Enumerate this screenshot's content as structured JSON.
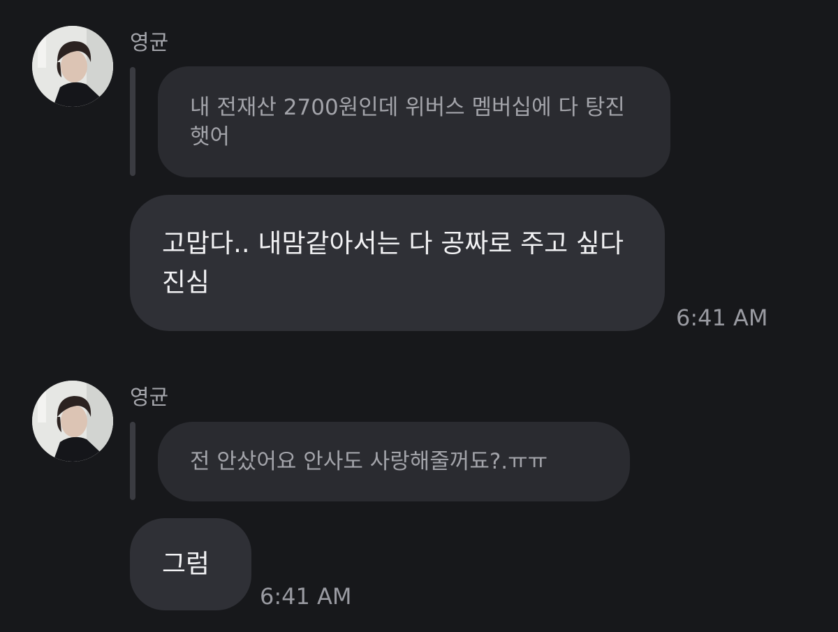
{
  "conversation": {
    "messages": [
      {
        "sender": "영균",
        "quoted_text": "내 전재산 2700원인데 위버스 멤버십에 다 탕진햇어",
        "reply_text": "고맙다.. 내맘같아서는 다 공짜로 주고 싶다 진심",
        "time": "6:41 AM"
      },
      {
        "sender": "영균",
        "quoted_text": "전 안샀어요 안사도 사랑해줄꺼됴?.ㅠㅠ",
        "reply_text": "그럼",
        "time": "6:41 AM"
      }
    ]
  }
}
